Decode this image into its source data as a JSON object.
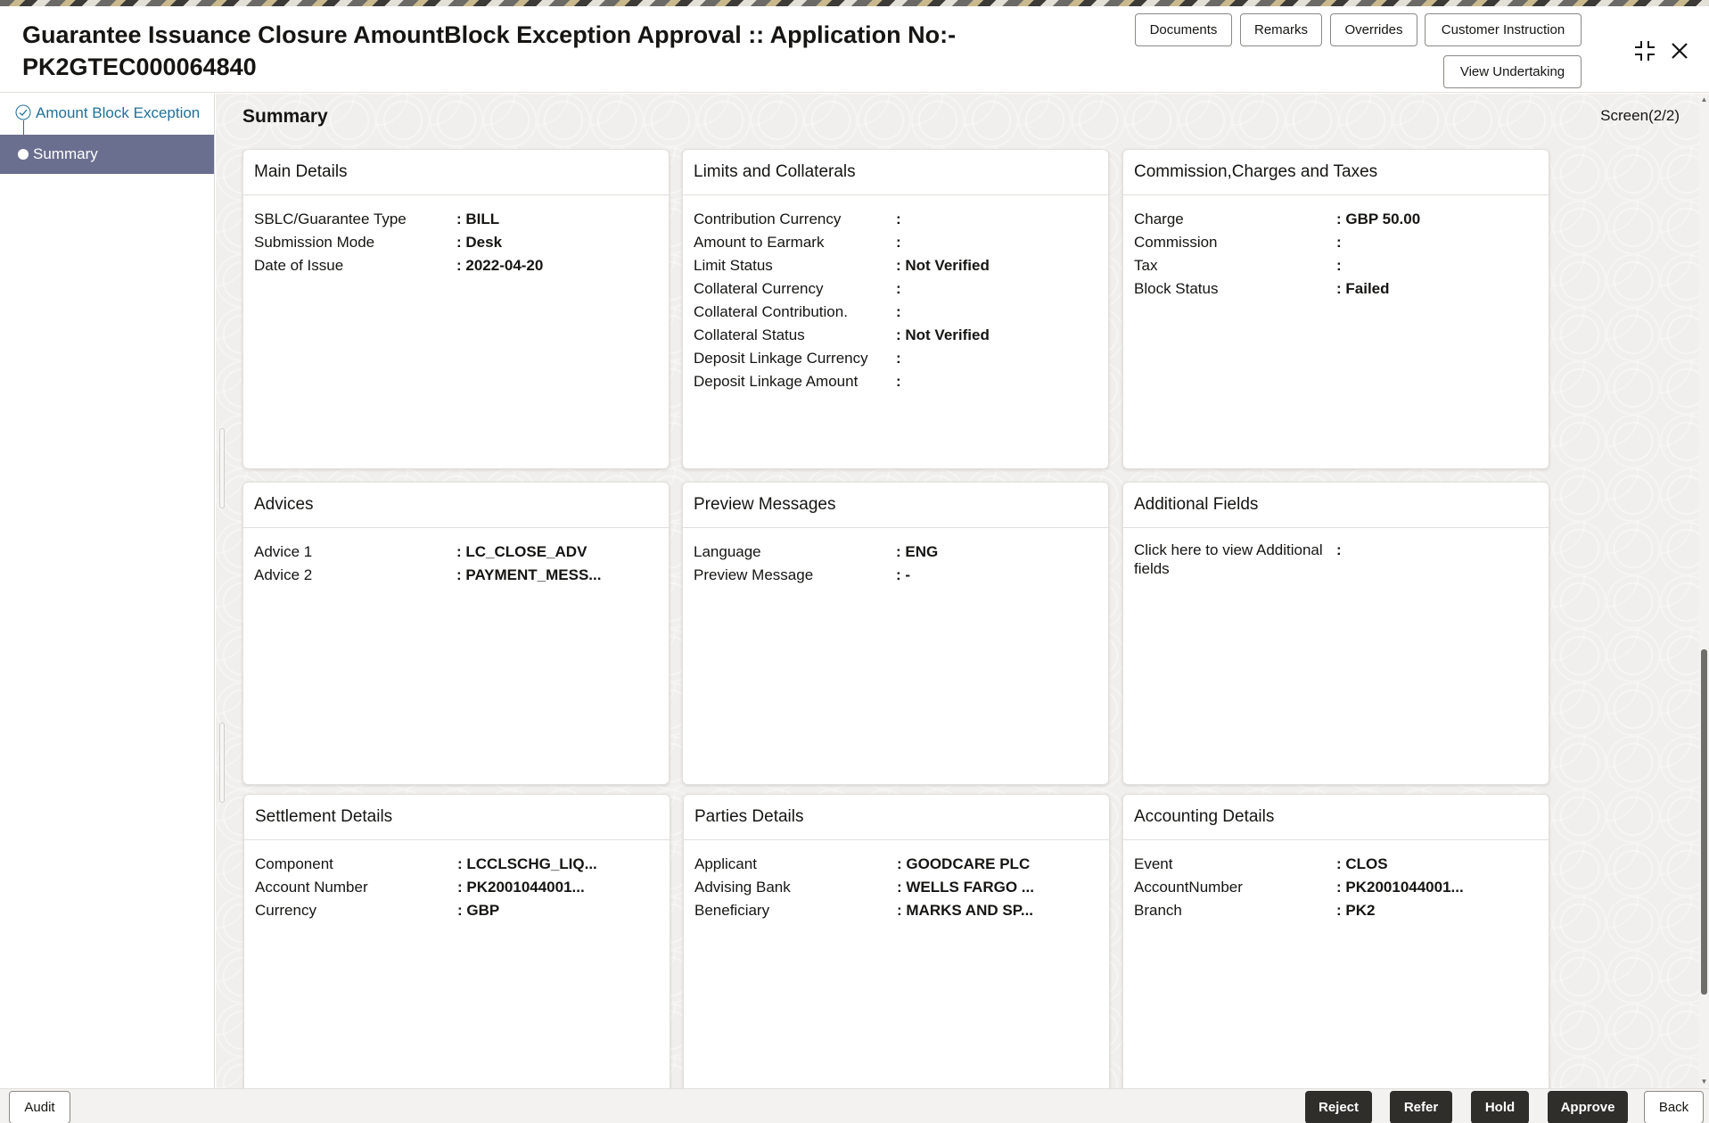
{
  "header": {
    "title_line1": "Guarantee Issuance Closure AmountBlock Exception Approval :: Application No:-",
    "title_line2": "PK2GTEC000064840",
    "buttons": {
      "documents": "Documents",
      "remarks": "Remarks",
      "overrides": "Overrides",
      "customer_instruction": "Customer Instruction",
      "view_undertaking": "View Undertaking"
    },
    "icons": {
      "minimize": "compress-icon",
      "close": "close-icon"
    }
  },
  "sidebar": {
    "items": [
      {
        "label": "Amount Block Exception",
        "state": "completed"
      },
      {
        "label": "Summary",
        "state": "active"
      }
    ]
  },
  "main": {
    "title": "Summary",
    "screen": "Screen(2/2)"
  },
  "cards": {
    "main_details": {
      "title": "Main Details",
      "rows": [
        {
          "label": "SBLC/Guarantee Type",
          "value": ": BILL"
        },
        {
          "label": "Submission Mode",
          "value": ": Desk"
        },
        {
          "label": "Date of Issue",
          "value": ": 2022-04-20"
        }
      ]
    },
    "limits": {
      "title": "Limits and Collaterals",
      "rows": [
        {
          "label": "Contribution Currency",
          "value": ":"
        },
        {
          "label": "Amount to Earmark",
          "value": ":"
        },
        {
          "label": "Limit Status",
          "value": ": Not Verified"
        },
        {
          "label": "Collateral Currency",
          "value": ":"
        },
        {
          "label": "Collateral Contribution.",
          "value": ":"
        },
        {
          "label": "Collateral Status",
          "value": ": Not Verified"
        },
        {
          "label": "Deposit Linkage Currency",
          "value": ":"
        },
        {
          "label": "Deposit Linkage Amount",
          "value": ":"
        }
      ]
    },
    "commission": {
      "title": "Commission,Charges and Taxes",
      "rows": [
        {
          "label": "Charge",
          "value": ": GBP  50.00"
        },
        {
          "label": "Commission",
          "value": ":"
        },
        {
          "label": "Tax",
          "value": ":"
        },
        {
          "label": "Block Status",
          "value": ": Failed"
        }
      ]
    },
    "advices": {
      "title": "Advices",
      "rows": [
        {
          "label": "Advice 1",
          "value": ": LC_CLOSE_ADV"
        },
        {
          "label": "Advice 2",
          "value": ": PAYMENT_MESS..."
        }
      ]
    },
    "preview": {
      "title": "Preview Messages",
      "rows": [
        {
          "label": "Language",
          "value": ": ENG"
        },
        {
          "label": "Preview Message",
          "value": ": -"
        }
      ]
    },
    "additional": {
      "title": "Additional Fields",
      "rows": [
        {
          "label": "Click here to view Additional fields",
          "value": ":"
        }
      ]
    },
    "settlement": {
      "title": "Settlement Details",
      "rows": [
        {
          "label": "Component",
          "value": ": LCCLSCHG_LIQ..."
        },
        {
          "label": "Account Number",
          "value": ": PK2001044001..."
        },
        {
          "label": "Currency",
          "value": ": GBP"
        }
      ]
    },
    "parties": {
      "title": "Parties Details",
      "rows": [
        {
          "label": "Applicant",
          "value": ": GOODCARE PLC"
        },
        {
          "label": "Advising Bank",
          "value": ": WELLS FARGO ..."
        },
        {
          "label": "Beneficiary",
          "value": ": MARKS AND SP..."
        }
      ]
    },
    "accounting": {
      "title": "Accounting Details",
      "rows": [
        {
          "label": "Event",
          "value": ": CLOS"
        },
        {
          "label": "AccountNumber",
          "value": ": PK2001044001..."
        },
        {
          "label": "Branch",
          "value": ": PK2"
        }
      ]
    }
  },
  "footer": {
    "audit": "Audit",
    "reject": "Reject",
    "refer": "Refer",
    "hold": "Hold",
    "approve": "Approve",
    "back": "Back"
  },
  "colors": {
    "accent": "#227199",
    "sidebar_active": "#6b6f8f",
    "dark_button": "#2f2e2b",
    "background": "#f1efed"
  }
}
